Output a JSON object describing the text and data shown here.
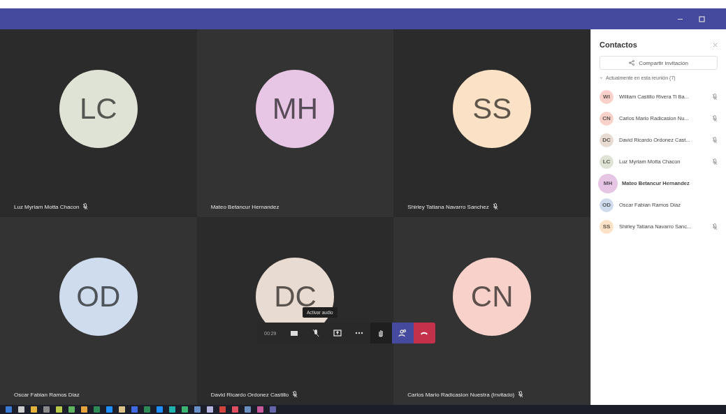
{
  "tiles": [
    {
      "initials": "LC",
      "name": "Luz Myriam Motta Chacon",
      "muted": true,
      "color": "#dfe3d6"
    },
    {
      "initials": "MH",
      "name": "Mateo Betancur Hernandez",
      "muted": false,
      "color": "#e6c6e4"
    },
    {
      "initials": "SS",
      "name": "Shirley Tatiana Navarro Sanchez",
      "muted": true,
      "color": "#fbe2c6"
    },
    {
      "initials": "OD",
      "name": "Oscar Fabian Ramos Diaz",
      "muted": false,
      "color": "#cfdcee"
    },
    {
      "initials": "DC",
      "name": "David Ricardo Ordonez Castillo",
      "muted": true,
      "color": "#e8dbd1"
    },
    {
      "initials": "CN",
      "name": "Carlos Mario Radicasion Nuestra (Invitado)",
      "muted": true,
      "color": "#f8d2ca"
    }
  ],
  "toolbar": {
    "timer": "00:29",
    "tooltip": "Activar audio"
  },
  "panel": {
    "title": "Contactos",
    "share": "Compartir invitación",
    "section": "Actualmente en esta reunión (7)",
    "people": [
      {
        "initials": "WI",
        "name": "William Castillo Rivera Ti Ba...",
        "muted": true,
        "speaking": false,
        "color": "#f8d2ca"
      },
      {
        "initials": "CN",
        "name": "Carlos Mario Radicasion Nu...",
        "muted": true,
        "speaking": false,
        "color": "#f8d2ca"
      },
      {
        "initials": "DC",
        "name": "David Ricardo Ordonez Cast...",
        "muted": true,
        "speaking": false,
        "color": "#e8dbd1"
      },
      {
        "initials": "LC",
        "name": "Luz Myriam Motta Chacon",
        "muted": true,
        "speaking": false,
        "color": "#dfe3d6"
      },
      {
        "initials": "MH",
        "name": "Mateo Betancur Hernandez",
        "muted": false,
        "speaking": true,
        "color": "#e6c6e4"
      },
      {
        "initials": "OD",
        "name": "Oscar Fabian Ramos Diaz",
        "muted": false,
        "speaking": false,
        "color": "#cfdcee"
      },
      {
        "initials": "SS",
        "name": "Shirley Tatiana Navarro Sanc...",
        "muted": true,
        "speaking": false,
        "color": "#fbe2c6"
      }
    ]
  }
}
